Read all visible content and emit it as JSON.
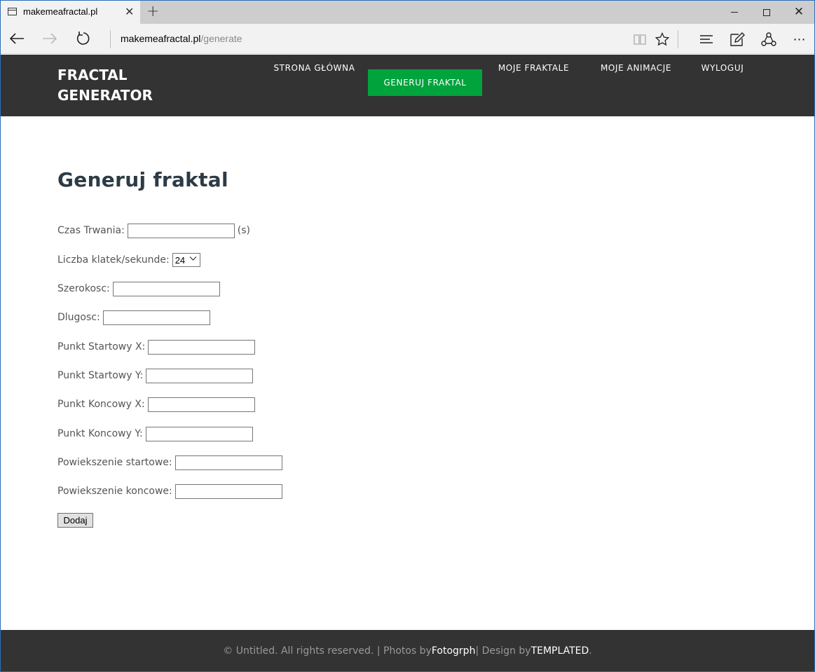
{
  "browser": {
    "tab_title": "makemeafractal.pl",
    "close_tab": "✕",
    "new_tab": "+",
    "url_domain": "makemeafractal.pl",
    "url_path": "/generate"
  },
  "site": {
    "logo_line1": "FRACTAL",
    "logo_line2": "GENERATOR",
    "nav": [
      {
        "label": "STRONA GŁÓWNA",
        "active": false
      },
      {
        "label": "GENERUJ FRAKTAL",
        "active": true
      },
      {
        "label": "MOJE FRAKTALE",
        "active": false
      },
      {
        "label": "MOJE ANIMACJE",
        "active": false
      },
      {
        "label": "WYLOGUJ",
        "active": false
      }
    ],
    "accent_color": "#00a33c",
    "header_color": "#333333"
  },
  "main": {
    "title": "Generuj fraktal",
    "fields": {
      "duration": {
        "label": "Czas Trwania:",
        "value": "",
        "suffix": "(s)"
      },
      "fps": {
        "label": "Liczba klatek/sekunde:",
        "value": "24"
      },
      "width": {
        "label": "Szerokosc:",
        "value": ""
      },
      "length": {
        "label": "Dlugosc:",
        "value": ""
      },
      "start_x": {
        "label": "Punkt Startowy X:",
        "value": ""
      },
      "start_y": {
        "label": "Punkt Startowy Y:",
        "value": ""
      },
      "end_x": {
        "label": "Punkt Koncowy X:",
        "value": ""
      },
      "end_y": {
        "label": "Punkt Koncowy Y:",
        "value": ""
      },
      "zoom_start": {
        "label": "Powiekszenie startowe:",
        "value": ""
      },
      "zoom_end": {
        "label": "Powiekszenie koncowe:",
        "value": ""
      }
    },
    "submit_label": "Dodaj"
  },
  "footer": {
    "text1": "© Untitled. All rights reserved. | Photos by ",
    "link1": "Fotogrph",
    "text2": " | Design by ",
    "link2": "TEMPLATED",
    "text3": "."
  }
}
